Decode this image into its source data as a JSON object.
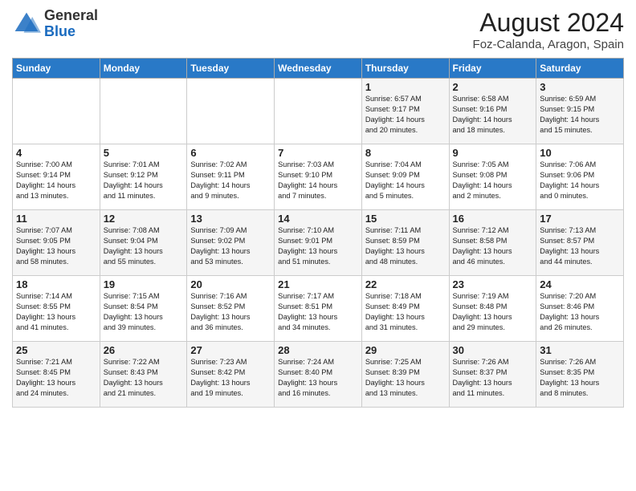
{
  "header": {
    "logo_general": "General",
    "logo_blue": "Blue",
    "month_year": "August 2024",
    "location": "Foz-Calanda, Aragon, Spain"
  },
  "days_of_week": [
    "Sunday",
    "Monday",
    "Tuesday",
    "Wednesday",
    "Thursday",
    "Friday",
    "Saturday"
  ],
  "weeks": [
    [
      {
        "day": "",
        "content": ""
      },
      {
        "day": "",
        "content": ""
      },
      {
        "day": "",
        "content": ""
      },
      {
        "day": "",
        "content": ""
      },
      {
        "day": "1",
        "content": "Sunrise: 6:57 AM\nSunset: 9:17 PM\nDaylight: 14 hours\nand 20 minutes."
      },
      {
        "day": "2",
        "content": "Sunrise: 6:58 AM\nSunset: 9:16 PM\nDaylight: 14 hours\nand 18 minutes."
      },
      {
        "day": "3",
        "content": "Sunrise: 6:59 AM\nSunset: 9:15 PM\nDaylight: 14 hours\nand 15 minutes."
      }
    ],
    [
      {
        "day": "4",
        "content": "Sunrise: 7:00 AM\nSunset: 9:14 PM\nDaylight: 14 hours\nand 13 minutes."
      },
      {
        "day": "5",
        "content": "Sunrise: 7:01 AM\nSunset: 9:12 PM\nDaylight: 14 hours\nand 11 minutes."
      },
      {
        "day": "6",
        "content": "Sunrise: 7:02 AM\nSunset: 9:11 PM\nDaylight: 14 hours\nand 9 minutes."
      },
      {
        "day": "7",
        "content": "Sunrise: 7:03 AM\nSunset: 9:10 PM\nDaylight: 14 hours\nand 7 minutes."
      },
      {
        "day": "8",
        "content": "Sunrise: 7:04 AM\nSunset: 9:09 PM\nDaylight: 14 hours\nand 5 minutes."
      },
      {
        "day": "9",
        "content": "Sunrise: 7:05 AM\nSunset: 9:08 PM\nDaylight: 14 hours\nand 2 minutes."
      },
      {
        "day": "10",
        "content": "Sunrise: 7:06 AM\nSunset: 9:06 PM\nDaylight: 14 hours\nand 0 minutes."
      }
    ],
    [
      {
        "day": "11",
        "content": "Sunrise: 7:07 AM\nSunset: 9:05 PM\nDaylight: 13 hours\nand 58 minutes."
      },
      {
        "day": "12",
        "content": "Sunrise: 7:08 AM\nSunset: 9:04 PM\nDaylight: 13 hours\nand 55 minutes."
      },
      {
        "day": "13",
        "content": "Sunrise: 7:09 AM\nSunset: 9:02 PM\nDaylight: 13 hours\nand 53 minutes."
      },
      {
        "day": "14",
        "content": "Sunrise: 7:10 AM\nSunset: 9:01 PM\nDaylight: 13 hours\nand 51 minutes."
      },
      {
        "day": "15",
        "content": "Sunrise: 7:11 AM\nSunset: 8:59 PM\nDaylight: 13 hours\nand 48 minutes."
      },
      {
        "day": "16",
        "content": "Sunrise: 7:12 AM\nSunset: 8:58 PM\nDaylight: 13 hours\nand 46 minutes."
      },
      {
        "day": "17",
        "content": "Sunrise: 7:13 AM\nSunset: 8:57 PM\nDaylight: 13 hours\nand 44 minutes."
      }
    ],
    [
      {
        "day": "18",
        "content": "Sunrise: 7:14 AM\nSunset: 8:55 PM\nDaylight: 13 hours\nand 41 minutes."
      },
      {
        "day": "19",
        "content": "Sunrise: 7:15 AM\nSunset: 8:54 PM\nDaylight: 13 hours\nand 39 minutes."
      },
      {
        "day": "20",
        "content": "Sunrise: 7:16 AM\nSunset: 8:52 PM\nDaylight: 13 hours\nand 36 minutes."
      },
      {
        "day": "21",
        "content": "Sunrise: 7:17 AM\nSunset: 8:51 PM\nDaylight: 13 hours\nand 34 minutes."
      },
      {
        "day": "22",
        "content": "Sunrise: 7:18 AM\nSunset: 8:49 PM\nDaylight: 13 hours\nand 31 minutes."
      },
      {
        "day": "23",
        "content": "Sunrise: 7:19 AM\nSunset: 8:48 PM\nDaylight: 13 hours\nand 29 minutes."
      },
      {
        "day": "24",
        "content": "Sunrise: 7:20 AM\nSunset: 8:46 PM\nDaylight: 13 hours\nand 26 minutes."
      }
    ],
    [
      {
        "day": "25",
        "content": "Sunrise: 7:21 AM\nSunset: 8:45 PM\nDaylight: 13 hours\nand 24 minutes."
      },
      {
        "day": "26",
        "content": "Sunrise: 7:22 AM\nSunset: 8:43 PM\nDaylight: 13 hours\nand 21 minutes."
      },
      {
        "day": "27",
        "content": "Sunrise: 7:23 AM\nSunset: 8:42 PM\nDaylight: 13 hours\nand 19 minutes."
      },
      {
        "day": "28",
        "content": "Sunrise: 7:24 AM\nSunset: 8:40 PM\nDaylight: 13 hours\nand 16 minutes."
      },
      {
        "day": "29",
        "content": "Sunrise: 7:25 AM\nSunset: 8:39 PM\nDaylight: 13 hours\nand 13 minutes."
      },
      {
        "day": "30",
        "content": "Sunrise: 7:26 AM\nSunset: 8:37 PM\nDaylight: 13 hours\nand 11 minutes."
      },
      {
        "day": "31",
        "content": "Sunrise: 7:26 AM\nSunset: 8:35 PM\nDaylight: 13 hours\nand 8 minutes."
      }
    ]
  ]
}
